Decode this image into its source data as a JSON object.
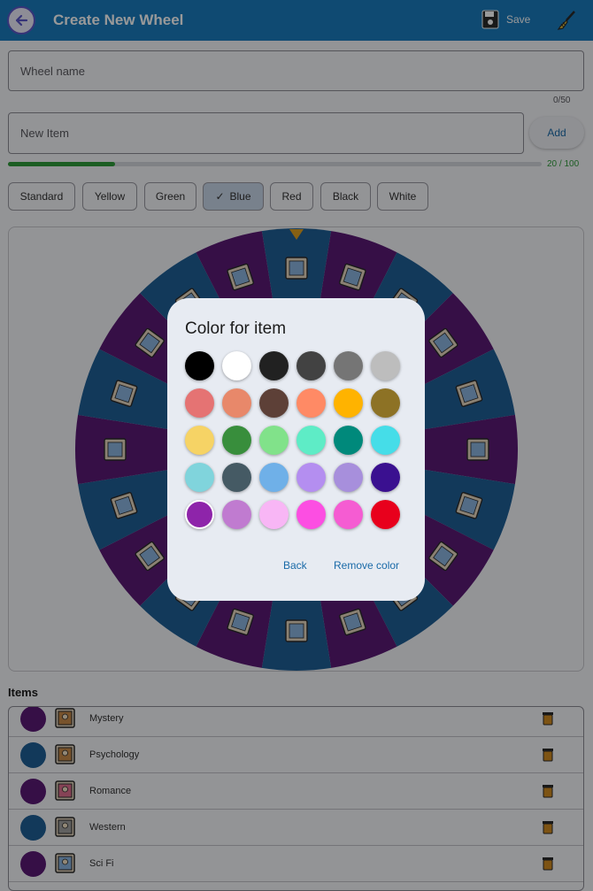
{
  "appbar": {
    "title": "Create New Wheel",
    "save_label": "Save",
    "background": "#1a7cbf"
  },
  "wheel_name": {
    "placeholder": "Wheel name",
    "value": "",
    "counter": "0/50"
  },
  "new_item": {
    "placeholder": "New Item",
    "value": "",
    "add_label": "Add"
  },
  "progress": {
    "value": 20,
    "max": 100,
    "label": "20 / 100"
  },
  "chips": [
    {
      "label": "Standard",
      "selected": false
    },
    {
      "label": "Yellow",
      "selected": false
    },
    {
      "label": "Green",
      "selected": false
    },
    {
      "label": "Blue",
      "selected": true
    },
    {
      "label": "Red",
      "selected": false
    },
    {
      "label": "Black",
      "selected": false
    },
    {
      "label": "White",
      "selected": false
    }
  ],
  "wheel": {
    "segments": 20,
    "colors": [
      "#1f5f96",
      "#5a1a75"
    ],
    "pointer_color": "#e0a020"
  },
  "items": {
    "title": "Items",
    "rows": [
      {
        "label": "Mystery",
        "color": "#5a1a75",
        "icon": "movie-genre-icon"
      },
      {
        "label": "Psychology",
        "color": "#1f5f96",
        "icon": "movie-genre-icon"
      },
      {
        "label": "Romance",
        "color": "#5a1a75",
        "icon": "movie-genre-icon"
      },
      {
        "label": "Western",
        "color": "#1f5f96",
        "icon": "movie-genre-icon"
      },
      {
        "label": "Sci Fi",
        "color": "#5a1a75",
        "icon": "movie-genre-icon"
      }
    ]
  },
  "dialog": {
    "title": "Color for item",
    "back_label": "Back",
    "remove_label": "Remove color",
    "swatches": [
      [
        "#000000",
        "#ffffff",
        "#212121",
        "#424242",
        "#757575",
        "#bdbdbd"
      ],
      [
        "#e57373",
        "#e8886a",
        "#5d4037",
        "#ff8a65",
        "#ffb300",
        "#8d7225"
      ],
      [
        "#f6d365",
        "#388e3c",
        "#81e28a",
        "#5eecc6",
        "#00897b",
        "#45dde8"
      ],
      [
        "#80d4dc",
        "#455a64",
        "#6fb0e8",
        "#b48ef0",
        "#a78fdc",
        "#3a1090"
      ],
      [
        "#8e24aa",
        "#c07bd0",
        "#f8b6f5",
        "#fc4ee2",
        "#f55cd2",
        "#e8001c"
      ]
    ],
    "selected_swatch": [
      4,
      0
    ]
  }
}
